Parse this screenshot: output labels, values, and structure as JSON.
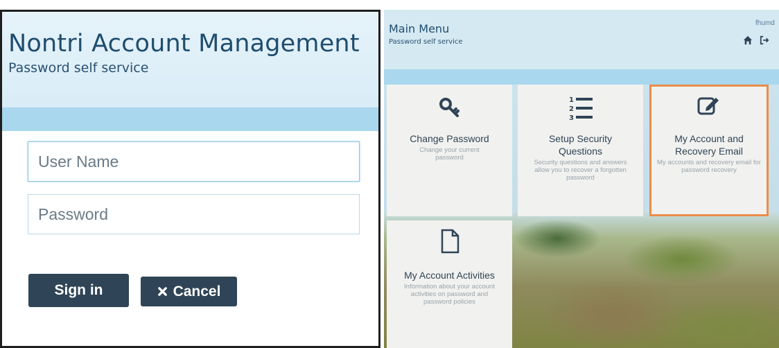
{
  "login": {
    "title": "Nontri Account Management",
    "subtitle": "Password self service",
    "username_placeholder": "User Name",
    "password_placeholder": "Password",
    "signin_label": "Sign in",
    "cancel_label": "Cancel"
  },
  "menu": {
    "title": "Main Menu",
    "subtitle": "Password self service",
    "user_label": "fhumd",
    "tiles": [
      {
        "icon": "key-icon",
        "title": "Change Password",
        "desc": "Change your current password"
      },
      {
        "icon": "ordered-list-icon",
        "title": "Setup Security Questions",
        "desc": "Security questions and answers allow you to recover a forgotten password"
      },
      {
        "icon": "edit-icon",
        "title": "My Account and Recovery Email",
        "desc": "My accounts and recovery email for password recovery",
        "selected": true
      },
      {
        "icon": "document-icon",
        "title": "My Account Activities",
        "desc": "Information about your account activities on password and password policies"
      }
    ]
  },
  "colors": {
    "header_bg": "#d6ebf6",
    "band": "#a9d7ee",
    "button": "#2f4456",
    "title_text": "#1f4d6e",
    "selected_outline": "#ec8c4a"
  }
}
